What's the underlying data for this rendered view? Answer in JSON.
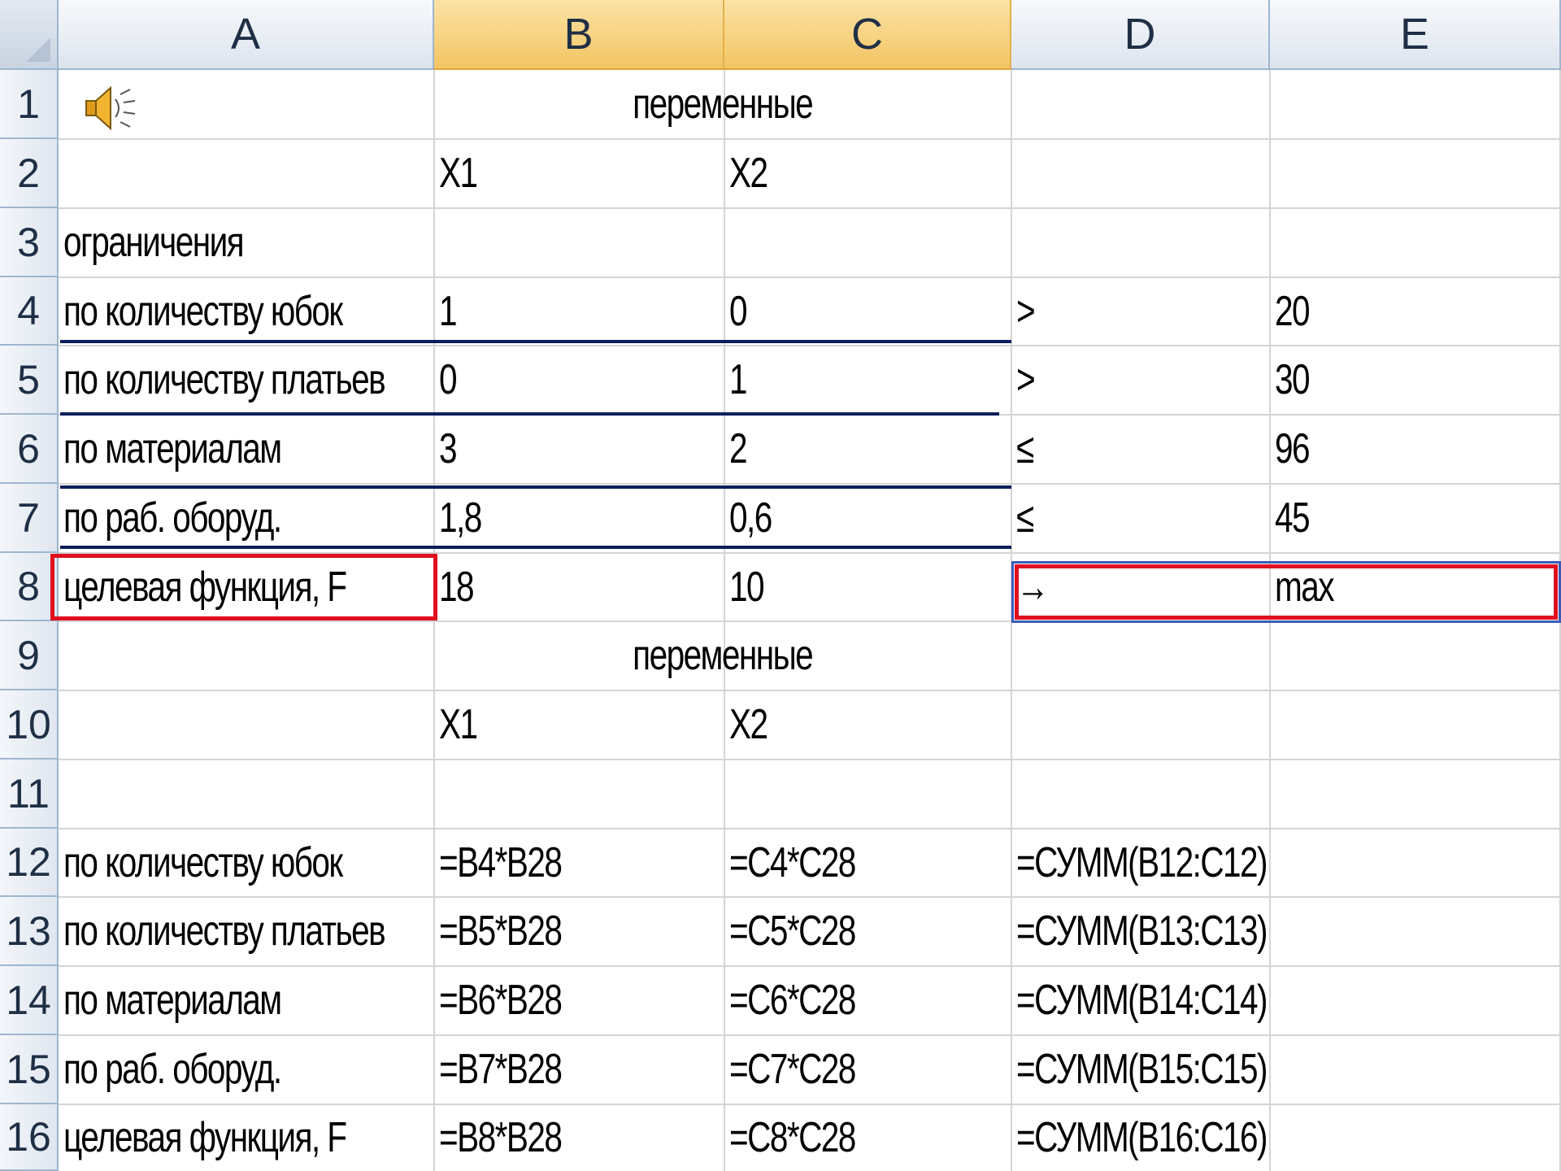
{
  "columns": [
    "A",
    "B",
    "C",
    "D",
    "E"
  ],
  "selected_columns": [
    "B",
    "C"
  ],
  "rows": [
    "1",
    "2",
    "3",
    "4",
    "5",
    "6",
    "7",
    "8",
    "9",
    "10",
    "11",
    "12",
    "13",
    "14",
    "15",
    "16"
  ],
  "speaker_icon": "speaker-sound-icon",
  "cells": {
    "r1_bc": "переменные",
    "r2_b": "X1",
    "r2_c": "X2",
    "r3_a": "ограничения",
    "r4_a": "по количеству юбок",
    "r4_b": "1",
    "r4_c": "0",
    "r4_d": ">",
    "r4_e": "20",
    "r5_a": "по количеству платьев",
    "r5_b": "0",
    "r5_c": "1",
    "r5_d": ">",
    "r5_e": "30",
    "r6_a": "по материалам",
    "r6_b": "3",
    "r6_c": "2",
    "r6_d": "≤",
    "r6_e": "96",
    "r7_a": "по раб. оборуд.",
    "r7_b": "1,8",
    "r7_c": "0,6",
    "r7_d": "≤",
    "r7_e": "45",
    "r8_a": "целевая функция, F",
    "r8_b": "18",
    "r8_c": "10",
    "r8_d": "→",
    "r8_e": "max",
    "r9_bc": "переменные",
    "r10_b": "X1",
    "r10_c": "X2",
    "r12_a": "по количеству юбок",
    "r12_b": "=B4*B28",
    "r12_c": "=C4*C28",
    "r12_d": "=СУММ(B12:C12)",
    "r13_a": "по количеству платьев",
    "r13_b": "=B5*B28",
    "r13_c": "=C5*C28",
    "r13_d": "=СУММ(B13:C13)",
    "r14_a": "по материалам",
    "r14_b": "=B6*B28",
    "r14_c": "=C6*C28",
    "r14_d": "=СУММ(B14:C14)",
    "r15_a": "по раб. оборуд.",
    "r15_b": "=B7*B28",
    "r15_c": "=C7*C28",
    "r15_d": "=СУММ(B15:C15)",
    "r16_a": "целевая функция, F",
    "r16_b": "=B8*B28",
    "r16_c": "=C8*C28",
    "r16_d": "=СУММ(B16:C16)"
  },
  "colors": {
    "highlight_border": "#e0101e",
    "underline": "#0b1f5c",
    "selected_header": "#f3c463"
  }
}
